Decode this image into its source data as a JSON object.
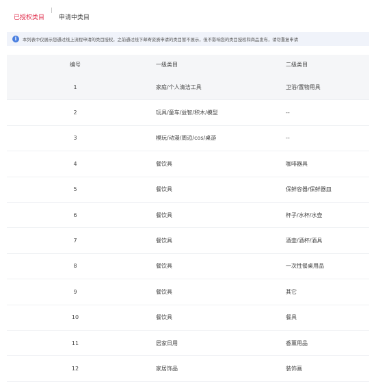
{
  "tabs": {
    "active": "已授权类目",
    "inactive": "申请中类目"
  },
  "notice": {
    "icon": "info-icon",
    "text": "本列表中仅展示您通过线上流程申请的类目授权，之前通过线下邮寄资质申请的类目暂不展示，但不影响您的类目授权和商品发布，请勿重复申请"
  },
  "table": {
    "columns": [
      "编号",
      "一级类目",
      "二级类目"
    ],
    "rows": [
      [
        "1",
        "家庭/个人清洁工具",
        "卫浴/置物用具"
      ],
      [
        "2",
        "玩具/童车/益智/积木/模型",
        "--"
      ],
      [
        "3",
        "模玩/动漫/周边/cos/桌游",
        "--"
      ],
      [
        "4",
        "餐饮具",
        "咖啡器具"
      ],
      [
        "5",
        "餐饮具",
        "保鲜容器/保鲜器皿"
      ],
      [
        "6",
        "餐饮具",
        "杯子/水杯/水壶"
      ],
      [
        "7",
        "餐饮具",
        "酒壶/酒杯/酒具"
      ],
      [
        "8",
        "餐饮具",
        "一次性餐桌用品"
      ],
      [
        "9",
        "餐饮具",
        "其它"
      ],
      [
        "10",
        "餐饮具",
        "餐具"
      ],
      [
        "11",
        "居家日用",
        "香薰用品"
      ],
      [
        "12",
        "家居饰品",
        "装饰画"
      ]
    ]
  }
}
